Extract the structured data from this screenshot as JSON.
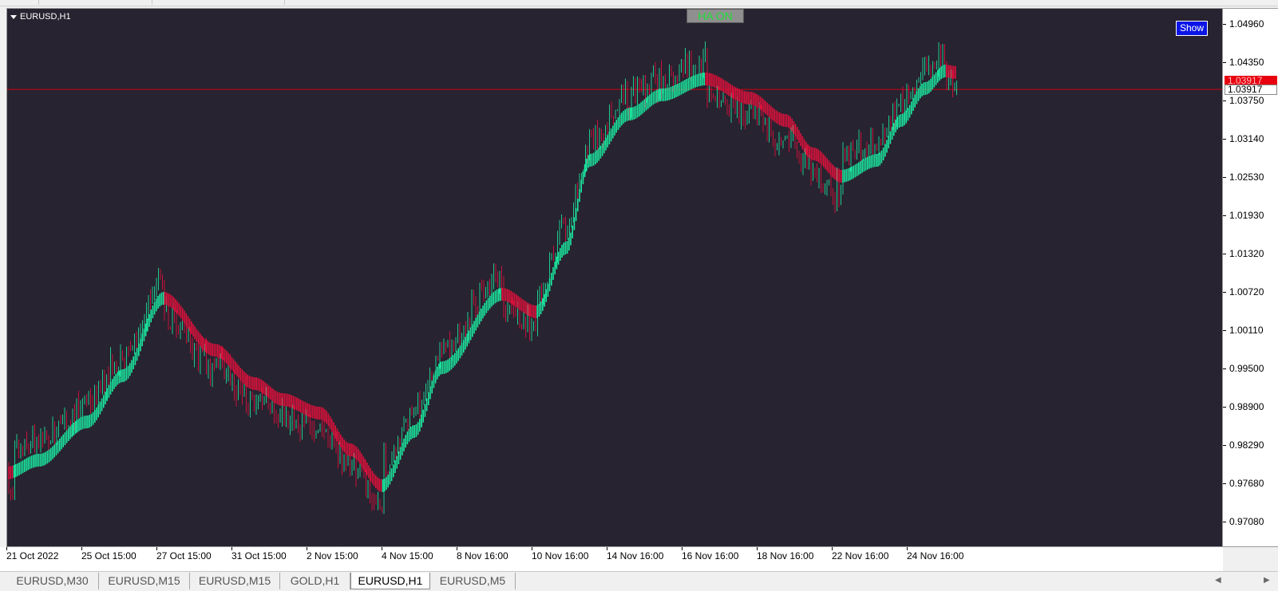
{
  "chart": {
    "symbol_label": "EURUSD,H1",
    "ha_button_label": "HA ON",
    "show_button_label": "Show",
    "current_price_label": "1.03917",
    "bid_price_label": "1.03917",
    "bid_line_color": "#d0000f",
    "background_color": "#282330",
    "bull_color": "#1ae8a0",
    "bear_color": "#e0103c",
    "price_levels": [
      "1.04960",
      "1.04350",
      "1.03750",
      "1.03140",
      "1.02530",
      "1.01930",
      "1.01320",
      "1.00720",
      "1.00110",
      "0.99500",
      "0.98900",
      "0.98290",
      "0.97680",
      "0.97080"
    ],
    "time_labels": [
      "21 Oct 2022",
      "25 Oct 15:00",
      "27 Oct 15:00",
      "31 Oct 15:00",
      "2 Nov 15:00",
      "4 Nov 15:00",
      "8 Nov 16:00",
      "10 Nov 16:00",
      "14 Nov 16:00",
      "16 Nov 16:00",
      "18 Nov 16:00",
      "22 Nov 16:00",
      "24 Nov 16:00"
    ]
  },
  "tabs": [
    {
      "label": "EURUSD,M30",
      "active": false
    },
    {
      "label": "EURUSD,M15",
      "active": false
    },
    {
      "label": "EURUSD,M15",
      "active": false
    },
    {
      "label": "GOLD,H1",
      "active": false
    },
    {
      "label": "EURUSD,H1",
      "active": true
    },
    {
      "label": "EURUSD,M5",
      "active": false
    }
  ],
  "scroll": {
    "left_icon": "scroll-left-icon",
    "right_icon": "scroll-right-icon"
  }
}
